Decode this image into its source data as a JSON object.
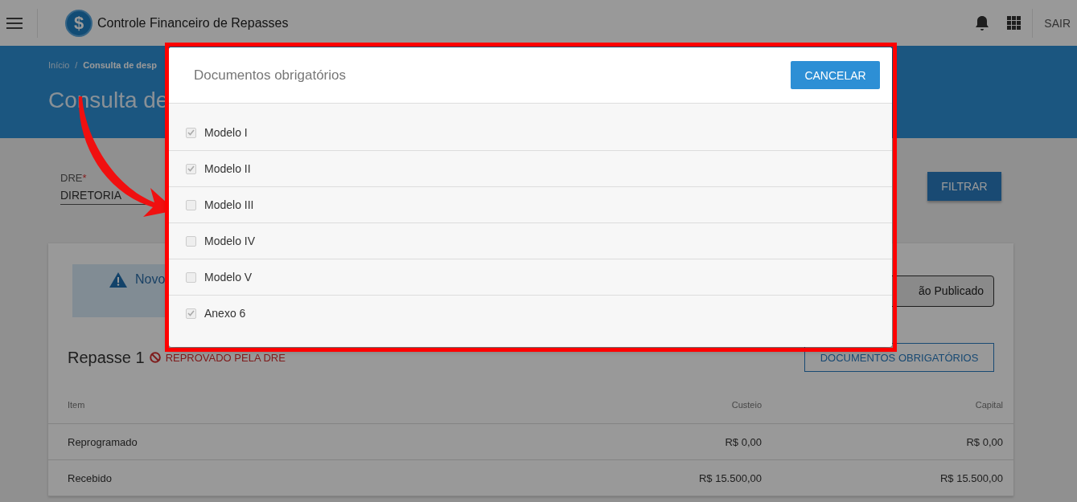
{
  "header": {
    "logo_symbol": "$",
    "app_title": "Controle Financeiro de Repasses",
    "logout": "SAIR"
  },
  "banner": {
    "breadcrumb": [
      "Início",
      "/",
      "Consulta de desp"
    ],
    "title": "Consulta de"
  },
  "filter": {
    "label": "DRE",
    "required_mark": "*",
    "value": "DIRETORIA",
    "button": "FILTRAR"
  },
  "alert": {
    "text": "Novo"
  },
  "status_button": "ão Publicado",
  "repasse": {
    "title": "Repasse 1",
    "status": "REPROVADO PELA DRE",
    "docs_button": "DOCUMENTOS OBRIGATÓRIOS"
  },
  "table": {
    "columns": [
      "Item",
      "Custeio",
      "Capital"
    ],
    "rows": [
      [
        "Reprogramado",
        "R$ 0,00",
        "R$ 0,00"
      ],
      [
        "Recebido",
        "R$ 15.500,00",
        "R$ 15.500,00"
      ]
    ]
  },
  "modal": {
    "title": "Documentos obrigatórios",
    "cancel": "CANCELAR",
    "items": [
      {
        "label": "Modelo I",
        "checked": true
      },
      {
        "label": "Modelo II",
        "checked": true
      },
      {
        "label": "Modelo III",
        "checked": false
      },
      {
        "label": "Modelo IV",
        "checked": false
      },
      {
        "label": "Modelo V",
        "checked": false
      },
      {
        "label": "Anexo 6",
        "checked": true
      }
    ]
  }
}
